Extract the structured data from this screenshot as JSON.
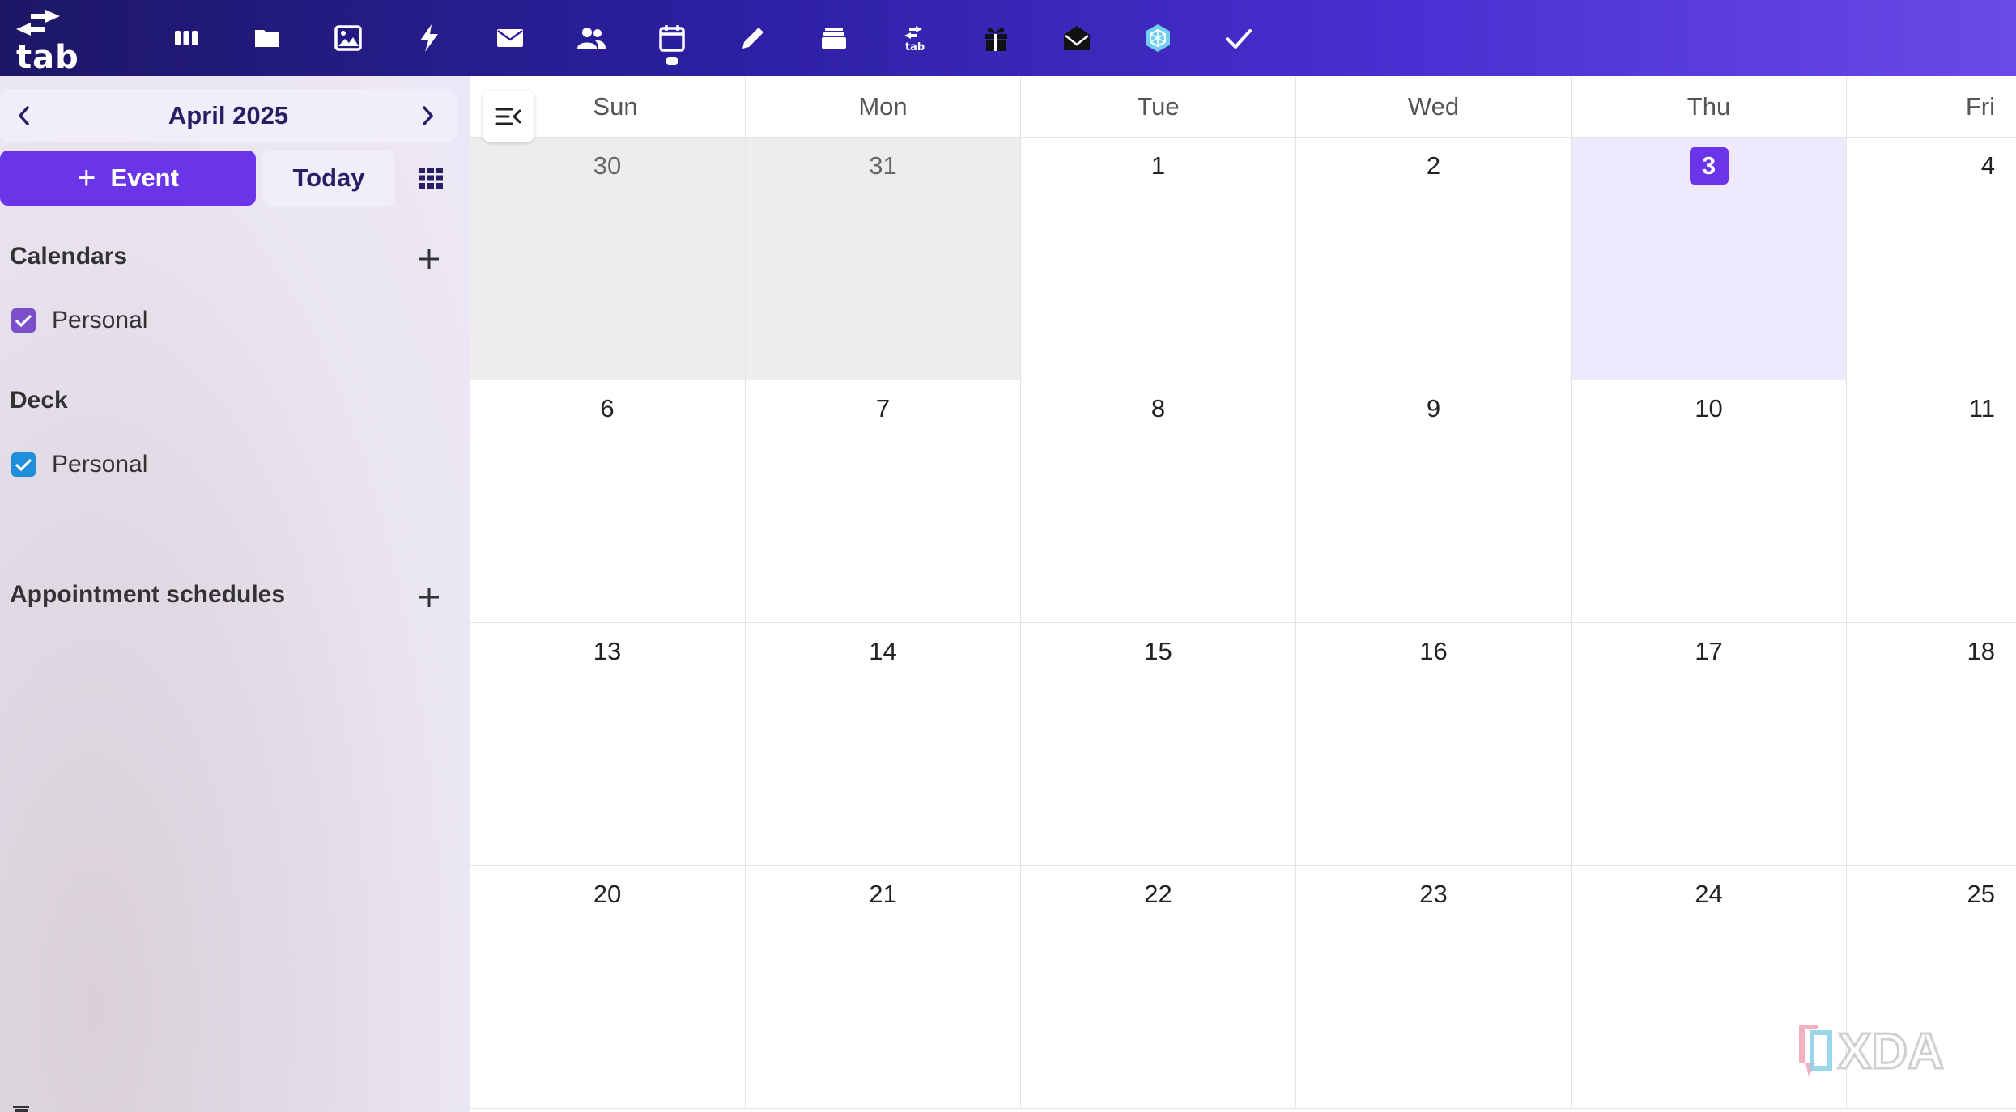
{
  "app": {
    "logo_text": "tab",
    "icons": [
      {
        "name": "boards-icon",
        "active": false
      },
      {
        "name": "folder-icon",
        "active": false
      },
      {
        "name": "image-icon",
        "active": false
      },
      {
        "name": "lightning-icon",
        "active": false
      },
      {
        "name": "mail-icon",
        "active": false
      },
      {
        "name": "contacts-icon",
        "active": false
      },
      {
        "name": "calendar-icon",
        "active": true
      },
      {
        "name": "pencil-icon",
        "active": false
      },
      {
        "name": "stack-icon",
        "active": false
      },
      {
        "name": "tab-swap-icon",
        "active": false,
        "label": "tab"
      },
      {
        "name": "gift-icon",
        "active": false
      },
      {
        "name": "open-mail-icon",
        "active": false
      },
      {
        "name": "hexagon-app-icon",
        "active": false
      },
      {
        "name": "checkmark-icon",
        "active": false
      }
    ]
  },
  "sidebar": {
    "month": "April 2025",
    "event_label": "Event",
    "today_label": "Today",
    "calendars_title": "Calendars",
    "calendars": [
      {
        "label": "Personal",
        "color": "#7b4fc9",
        "checked": true
      }
    ],
    "deck_title": "Deck",
    "deck": [
      {
        "label": "Personal",
        "color": "#1f8fdc",
        "checked": true
      }
    ],
    "appointments_title": "Appointment schedules"
  },
  "calendar": {
    "weekdays": [
      "Sun",
      "Mon",
      "Tue",
      "Wed",
      "Thu",
      "Fri"
    ],
    "weeks": [
      [
        {
          "d": "30",
          "other": true
        },
        {
          "d": "31",
          "other": true
        },
        {
          "d": "1"
        },
        {
          "d": "2"
        },
        {
          "d": "3",
          "today": true
        },
        {
          "d": "4"
        }
      ],
      [
        {
          "d": "6"
        },
        {
          "d": "7"
        },
        {
          "d": "8"
        },
        {
          "d": "9"
        },
        {
          "d": "10"
        },
        {
          "d": "11"
        }
      ],
      [
        {
          "d": "13"
        },
        {
          "d": "14"
        },
        {
          "d": "15"
        },
        {
          "d": "16"
        },
        {
          "d": "17"
        },
        {
          "d": "18"
        }
      ],
      [
        {
          "d": "20"
        },
        {
          "d": "21"
        },
        {
          "d": "22"
        },
        {
          "d": "23"
        },
        {
          "d": "24"
        },
        {
          "d": "25"
        }
      ]
    ]
  },
  "colors": {
    "accent": "#6a35e8",
    "today_bg": "#efe9fd",
    "other_month_bg": "#ededed"
  }
}
